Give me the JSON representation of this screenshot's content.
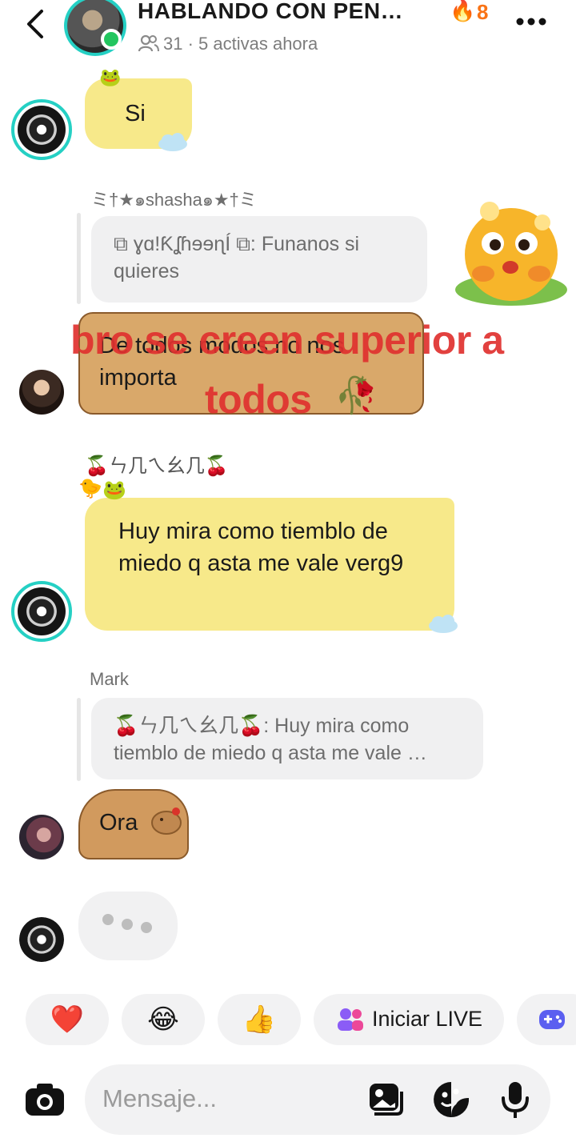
{
  "header": {
    "title": "HABLANDO CON PEN…",
    "streak_count": "8",
    "members_count": "31",
    "subtitle": "31 · 5 activas ahora",
    "accent_color": "#25d0c4",
    "online_color": "#22c55e",
    "streak_color": "#f97316"
  },
  "messages": [
    {
      "text": "Si",
      "style": "yellow-duck-frog"
    },
    {
      "sender": "ミ†★๑shasha๑★†ミ",
      "reply_preview": "⧉ ɣɑ!ƘʆɦɘɘɳÍ ⧉: Funanos si quieres",
      "text": "De todos modos no nos importa",
      "style": "brown"
    },
    {
      "sender": "🍒ㄣ几ㄟ幺几🍒",
      "text": "Huy mira como tiemblo de miedo q asta me vale verg9",
      "style": "yellow-duck-frog"
    },
    {
      "sender": "Mark",
      "reply_preview": "🍒ㄣ几ㄟ幺几🍒: Huy mira como tiemblo de miedo q asta me vale …",
      "text": "Ora",
      "style": "capybara"
    }
  ],
  "overlay": {
    "line1": "bro se creen superior a",
    "line2": "todos",
    "emoji": "🥀",
    "color": "#e0312f"
  },
  "quick_reactions": [
    "❤️",
    "😂",
    "👍"
  ],
  "live": {
    "label": "Iniciar LIVE"
  },
  "composer": {
    "placeholder": "Mensaje..."
  },
  "icons": [
    "back-arrow-icon",
    "members-icon",
    "fire-icon",
    "more-icon",
    "camera-icon",
    "gallery-icon",
    "sticker-icon",
    "microphone-icon",
    "gamepad-icon",
    "people-icon"
  ]
}
